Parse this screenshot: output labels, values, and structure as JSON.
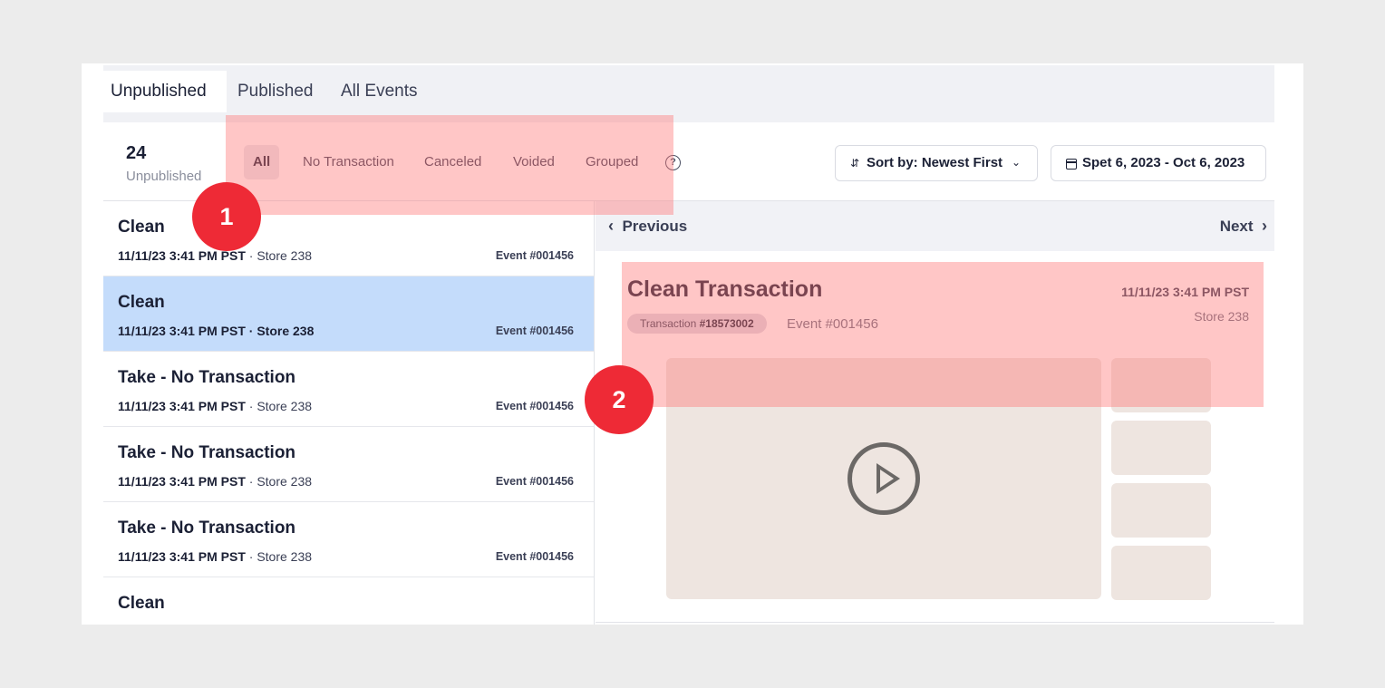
{
  "tabs": [
    {
      "label": "Unpublished"
    },
    {
      "label": "Published"
    },
    {
      "label": "All Events"
    }
  ],
  "summary": {
    "count": "24",
    "label": "Unpublished"
  },
  "filters": [
    {
      "label": "All"
    },
    {
      "label": "No Transaction"
    },
    {
      "label": "Canceled"
    },
    {
      "label": "Voided"
    },
    {
      "label": "Grouped"
    }
  ],
  "help_icon": "?",
  "sort": {
    "label": "Sort by: Newest First",
    "icon": "sort-icon",
    "chevron": "⌄"
  },
  "date_range": {
    "label": "Spet 6, 2023 - Oct 6, 2023",
    "icon": "calendar-icon"
  },
  "events": [
    {
      "title": "Clean",
      "datetime": "11/11/23 3:41 PM PST",
      "sep": " · ",
      "store": "Store 238",
      "event": "Event #001456"
    },
    {
      "title": "Clean",
      "datetime": "11/11/23 3:41 PM PST",
      "sep": " · ",
      "store": "Store 238",
      "event": "Event #001456"
    },
    {
      "title": "Take - No Transaction",
      "datetime": "11/11/23 3:41 PM PST",
      "sep": " · ",
      "store": "Store 238",
      "event": "Event #001456"
    },
    {
      "title": "Take - No Transaction",
      "datetime": "11/11/23 3:41 PM PST",
      "sep": " · ",
      "store": "Store 238",
      "event": "Event #001456"
    },
    {
      "title": "Take - No Transaction",
      "datetime": "11/11/23 3:41 PM PST",
      "sep": " · ",
      "store": "Store 238",
      "event": "Event #001456"
    },
    {
      "title": "Clean",
      "datetime": "",
      "sep": "",
      "store": "",
      "event": ""
    }
  ],
  "detail": {
    "previous": "Previous",
    "next": "Next",
    "title": "Clean Transaction",
    "datetime": "11/11/23 3:41 PM PST",
    "store": "Store 238",
    "transaction_prefix": "Transaction ",
    "transaction_id": "#18573002",
    "event": "Event #001456"
  },
  "annotations": {
    "one": "1",
    "two": "2"
  },
  "colors": {
    "selected_row": "#c4dcfb",
    "highlight": "#ff7878",
    "badge": "#ee2a36"
  }
}
